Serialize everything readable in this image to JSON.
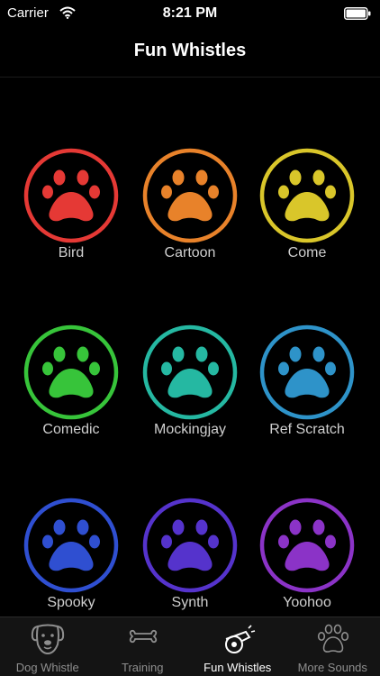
{
  "status_bar": {
    "carrier": "Carrier",
    "time": "8:21 PM"
  },
  "nav": {
    "title": "Fun Whistles"
  },
  "sounds": [
    {
      "label": "Bird",
      "color": "#e53935"
    },
    {
      "label": "Cartoon",
      "color": "#e8822a"
    },
    {
      "label": "Come",
      "color": "#d9c62a"
    },
    {
      "label": "Comedic",
      "color": "#37c43a"
    },
    {
      "label": "Mockingjay",
      "color": "#25b8a2"
    },
    {
      "label": "Ref Scratch",
      "color": "#2e93c9"
    },
    {
      "label": "Spooky",
      "color": "#2f4fd1"
    },
    {
      "label": "Synth",
      "color": "#5533cc"
    },
    {
      "label": "Yoohoo",
      "color": "#8b33c7"
    }
  ],
  "tabs": [
    {
      "label": "Dog Whistle",
      "icon": "dog-face-icon",
      "active": false
    },
    {
      "label": "Training",
      "icon": "bone-icon",
      "active": false
    },
    {
      "label": "Fun Whistles",
      "icon": "whistle-icon",
      "active": true
    },
    {
      "label": "More Sounds",
      "icon": "paw-outline-icon",
      "active": false
    }
  ]
}
